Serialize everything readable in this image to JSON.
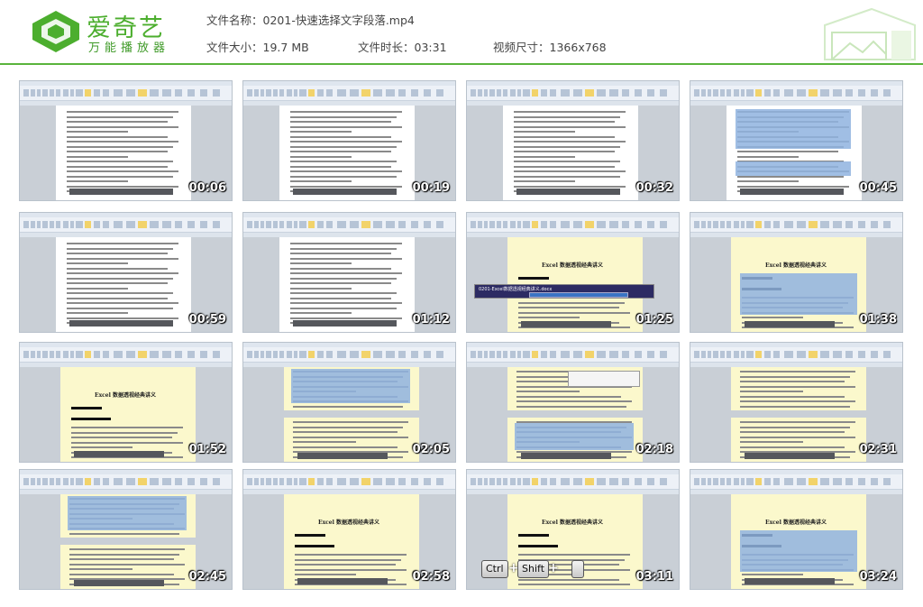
{
  "brand": {
    "name": "爱奇艺",
    "subtitle": "万能播放器"
  },
  "file_info": {
    "name_label": "文件名称：",
    "name_value": "0201-快速选择文字段落.mp4",
    "size_label": "文件大小：",
    "size_value": "19.7 MB",
    "duration_label": "文件时长：",
    "duration_value": "03:31",
    "dimensions_label": "视频尺寸：",
    "dimensions_value": "1366x768"
  },
  "colors": {
    "brand_green": "#4cae2e",
    "header_rule": "#5ab43c"
  },
  "thumbnails": [
    {
      "time": "00:06",
      "style": "white"
    },
    {
      "time": "00:19",
      "style": "white"
    },
    {
      "time": "00:32",
      "style": "white"
    },
    {
      "time": "00:45",
      "style": "white-selected"
    },
    {
      "time": "00:59",
      "style": "white"
    },
    {
      "time": "01:12",
      "style": "white"
    },
    {
      "time": "01:25",
      "style": "yellow-dialog"
    },
    {
      "time": "01:38",
      "style": "yellow-selected"
    },
    {
      "time": "01:52",
      "style": "yellow"
    },
    {
      "time": "02:05",
      "style": "yellow-split"
    },
    {
      "time": "02:18",
      "style": "yellow-split-menu"
    },
    {
      "time": "02:31",
      "style": "yellow-split"
    },
    {
      "time": "02:45",
      "style": "yellow-split"
    },
    {
      "time": "02:58",
      "style": "yellow"
    },
    {
      "time": "03:11",
      "style": "yellow-keys"
    },
    {
      "time": "03:24",
      "style": "yellow-selected"
    }
  ],
  "doc_title": "Excel 数据透视经典讲义",
  "dialog_text": "0201-Excel数据透视经典讲义.docx",
  "keys": [
    "Ctrl",
    "+",
    "Shift",
    "+"
  ]
}
